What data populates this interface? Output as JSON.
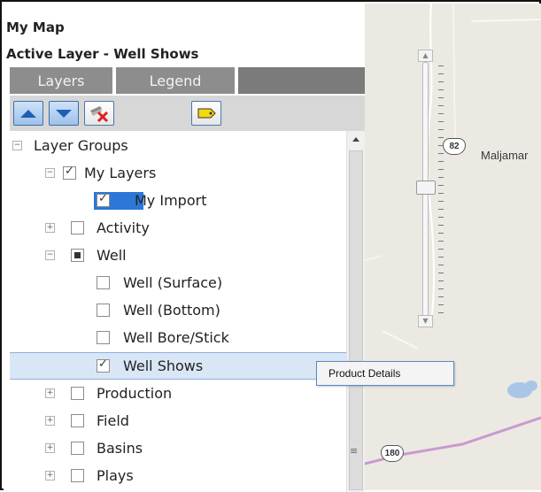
{
  "header": {
    "title": "My Map",
    "active_layer": "Active Layer - Well Shows"
  },
  "tabs": [
    {
      "label": "Layers"
    },
    {
      "label": "Legend"
    }
  ],
  "toolbar": {
    "buttons": [
      {
        "name": "move-up-button",
        "icon": "triangle-up-icon"
      },
      {
        "name": "move-down-button",
        "icon": "triangle-down-icon"
      },
      {
        "name": "remove-layer-button",
        "icon": "layer-remove-x-icon"
      },
      {
        "name": "label-tag-button",
        "icon": "tag-icon"
      }
    ]
  },
  "tree": {
    "root": {
      "label": "Layer Groups",
      "expanded": true
    },
    "items": [
      {
        "label": "My Layers",
        "checked": true,
        "expanded": true
      },
      {
        "label": "My Import",
        "checked": true
      },
      {
        "label": "Activity",
        "checked": false,
        "expanded": false
      },
      {
        "label": "Well",
        "checked": "partial",
        "expanded": true
      },
      {
        "label": "Well (Surface)",
        "checked": false
      },
      {
        "label": "Well (Bottom)",
        "checked": false
      },
      {
        "label": "Well Bore/Stick",
        "checked": false
      },
      {
        "label": "Well Shows",
        "checked": true,
        "selected": true
      },
      {
        "label": "Production",
        "checked": false,
        "expanded": false
      },
      {
        "label": "Field",
        "checked": false,
        "expanded": false
      },
      {
        "label": "Basins",
        "checked": false,
        "expanded": false
      },
      {
        "label": "Plays",
        "checked": false,
        "expanded": false
      }
    ]
  },
  "tooltip": {
    "text": "Product Details"
  },
  "map": {
    "town": "Maljamar",
    "shields": [
      {
        "label": "82"
      },
      {
        "label": "180"
      }
    ],
    "colors": {
      "road_major": "#c99ad0",
      "water": "#a9c6e6",
      "land": "#ece9e3"
    }
  }
}
